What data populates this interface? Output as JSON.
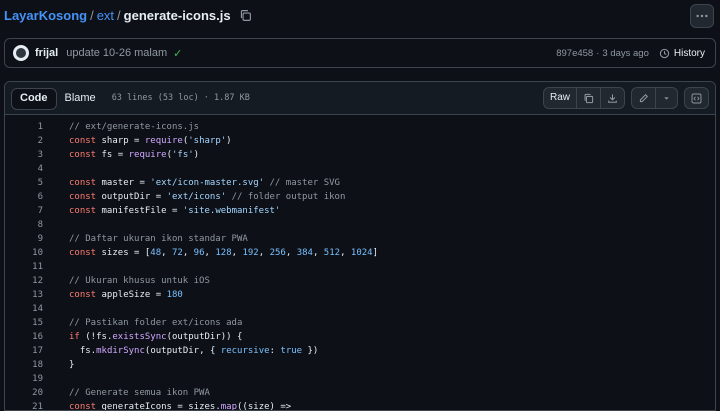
{
  "breadcrumb": {
    "repo": "LayarKosong",
    "sep1": "/",
    "folder": "ext",
    "sep2": "/",
    "file": "generate-icons.js"
  },
  "commit": {
    "author": "frijal",
    "message": "update 10-26 malam",
    "check": "✓",
    "hash": "897e458",
    "dot": "·",
    "time": "3 days ago",
    "history_label": "History"
  },
  "file_header": {
    "code_tab": "Code",
    "blame_tab": "Blame",
    "info": "63 lines (53 loc) · 1.87 KB",
    "raw_label": "Raw"
  },
  "code_lines": [
    {
      "n": "1",
      "t": "// ext/generate-icons.js"
    },
    {
      "n": "2",
      "t": "const sharp = require('sharp')"
    },
    {
      "n": "3",
      "t": "const fs = require('fs')"
    },
    {
      "n": "4",
      "t": ""
    },
    {
      "n": "5",
      "t": "const master = 'ext/icon-master.svg' // master SVG"
    },
    {
      "n": "6",
      "t": "const outputDir = 'ext/icons' // folder output ikon"
    },
    {
      "n": "7",
      "t": "const manifestFile = 'site.webmanifest'"
    },
    {
      "n": "8",
      "t": ""
    },
    {
      "n": "9",
      "t": "// Daftar ukuran ikon standar PWA"
    },
    {
      "n": "10",
      "t": "const sizes = [48, 72, 96, 128, 192, 256, 384, 512, 1024]"
    },
    {
      "n": "11",
      "t": ""
    },
    {
      "n": "12",
      "t": "// Ukuran khusus untuk iOS"
    },
    {
      "n": "13",
      "t": "const appleSize = 180"
    },
    {
      "n": "14",
      "t": ""
    },
    {
      "n": "15",
      "t": "// Pastikan folder ext/icons ada"
    },
    {
      "n": "16",
      "t": "if (!fs.existsSync(outputDir)) {"
    },
    {
      "n": "17",
      "t": "  fs.mkdirSync(outputDir, { recursive: true })"
    },
    {
      "n": "18",
      "t": "}"
    },
    {
      "n": "19",
      "t": ""
    },
    {
      "n": "20",
      "t": "// Generate semua ikon PWA"
    },
    {
      "n": "21",
      "t": "const generateIcons = sizes.map((size) =>"
    }
  ],
  "colors": {
    "background": "#0d1117",
    "link": "#4493f8",
    "keyword": "#ff7b72",
    "string": "#a5d6ff",
    "number": "#79c0ff",
    "function": "#d2a8ff",
    "comment": "#9198a1"
  },
  "icons": {
    "copy": "copy-icon",
    "more": "kebab-horizontal-icon",
    "history": "history-clock-icon",
    "copy_raw": "copy-icon",
    "download": "download-icon",
    "edit": "pencil-icon",
    "dropdown": "triangle-down-icon",
    "symbols": "code-square-icon"
  }
}
